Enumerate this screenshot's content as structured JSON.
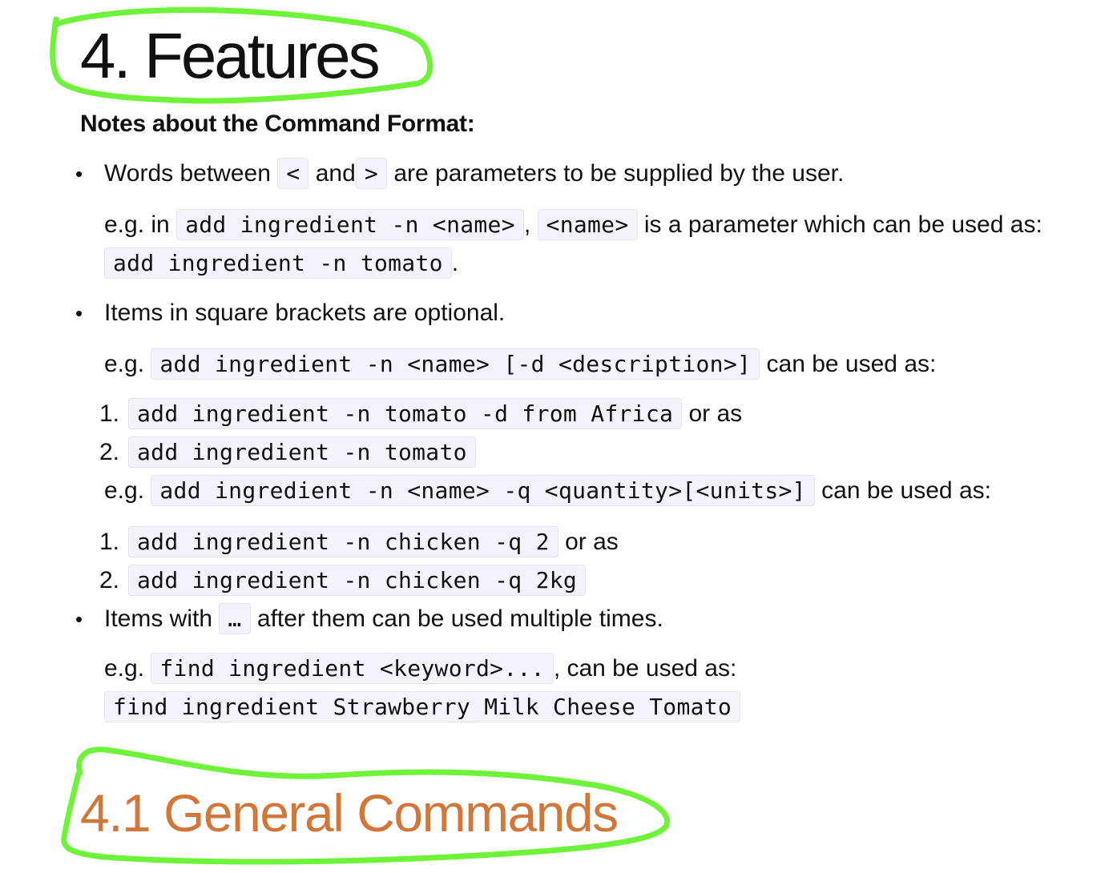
{
  "heading": "4. Features",
  "notes_title": "Notes about the Command Format:",
  "bullets": {
    "b1": {
      "t1": "Words between",
      "c1": "<",
      "t2": "and",
      "c2": ">",
      "t3": "are parameters to be supplied by the user.",
      "eg_prefix": "e.g. in",
      "eg_c1": "add ingredient -n <name>",
      "eg_sep": ",",
      "eg_c2": "<name>",
      "eg_t": "is a parameter which can be used as:",
      "eg_c3": "add ingredient -n tomato",
      "eg_end": "."
    },
    "b2": {
      "t1": "Items in square brackets are optional.",
      "eg1_prefix": "e.g.",
      "eg1_code": "add ingredient -n <name> [-d <description>]",
      "eg1_suffix": "can be used as:",
      "list1": [
        {
          "num": "1.",
          "code": "add ingredient -n tomato -d from Africa",
          "suffix": "or as"
        },
        {
          "num": "2.",
          "code": "add ingredient -n tomato",
          "suffix": ""
        }
      ],
      "eg2_prefix": "e.g.",
      "eg2_code": "add ingredient -n <name> -q <quantity>[<units>]",
      "eg2_suffix": "can be used as:",
      "list2": [
        {
          "num": "1.",
          "code": "add ingredient -n chicken -q 2",
          "suffix": "or as"
        },
        {
          "num": "2.",
          "code": "add ingredient -n chicken -q 2kg",
          "suffix": ""
        }
      ]
    },
    "b3": {
      "t1": "Items with",
      "c1": "…",
      "t2": "after them can be used multiple times.",
      "eg_prefix": "e.g.",
      "eg_code": "find ingredient <keyword>...",
      "eg_suffix": ", can be used as:",
      "eg_code2": "find ingredient Strawberry Milk Cheese Tomato"
    }
  },
  "bullet_symbol": "•",
  "subheading": "4.1 General Commands",
  "colors": {
    "text": "#111111",
    "subheading": "#d2773a",
    "code_bg": "#f3f3fb",
    "code_border": "#e4e4ef",
    "annotation_stroke": "#6ef23a"
  }
}
